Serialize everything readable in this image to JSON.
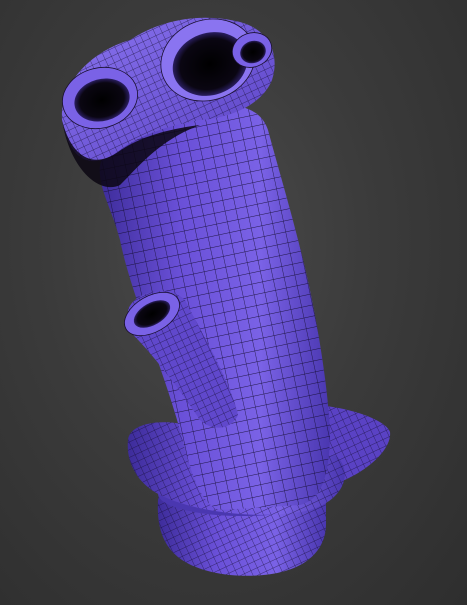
{
  "viewport": {
    "background_color": "#3b3b3b",
    "model": {
      "shading": "wireframe-over-shaded",
      "base_color": "#6a4fd6",
      "shadow_color": "#3a2a8a",
      "highlight_color": "#ffffff",
      "wire_color": "#1a1030",
      "parts": [
        "main-tube",
        "top-dual-inlet-flange",
        "left-bore",
        "right-bore",
        "side-nozzle",
        "base-collar",
        "base-flange-plate"
      ]
    }
  }
}
